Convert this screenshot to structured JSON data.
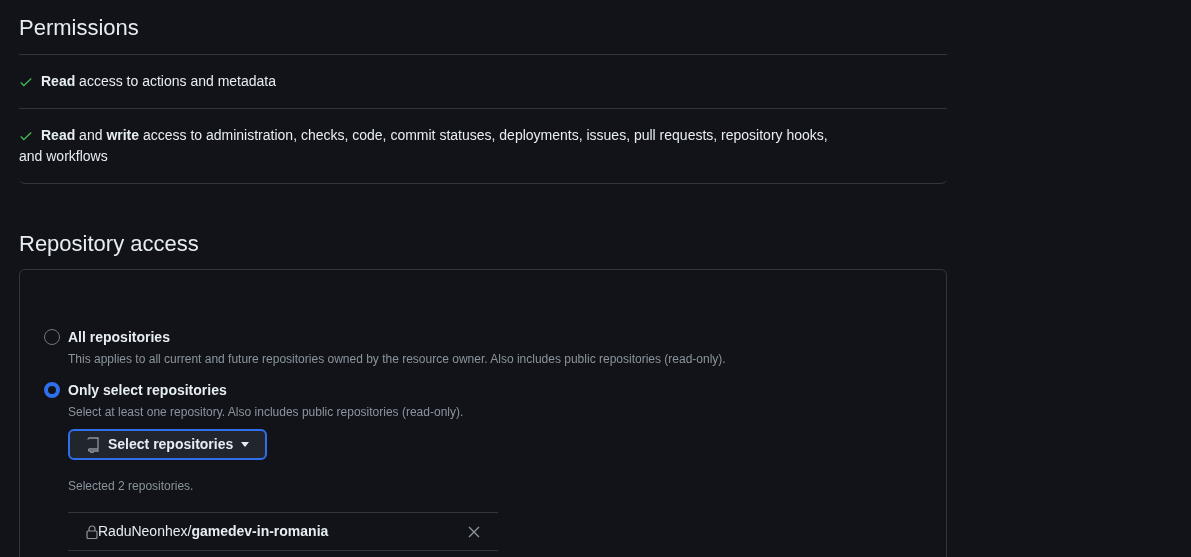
{
  "permissions": {
    "title": "Permissions",
    "items": [
      {
        "text": "**Read** access to actions and metadata",
        "granted": true
      },
      {
        "text": "**Read** and **write** access to administration, checks, code, commit statuses, deployments, issues, pull requests, repository hooks, and workflows",
        "granted": true
      }
    ]
  },
  "repository_access": {
    "title": "Repository access",
    "options": [
      {
        "label": "All repositories",
        "description": "This applies to all current and future repositories owned by the resource owner. Also includes public repositories (read-only).",
        "selected": false
      },
      {
        "label": "Only select repositories",
        "description": "Select at least one repository. Also includes public repositories (read-only).",
        "selected": true
      }
    ],
    "select_button": "Select repositories",
    "selected_count": "Selected 2 repositories.",
    "repositories": [
      {
        "name": "RaduNeonhex/**gamedev-in-romania**",
        "private": true
      }
    ]
  }
}
